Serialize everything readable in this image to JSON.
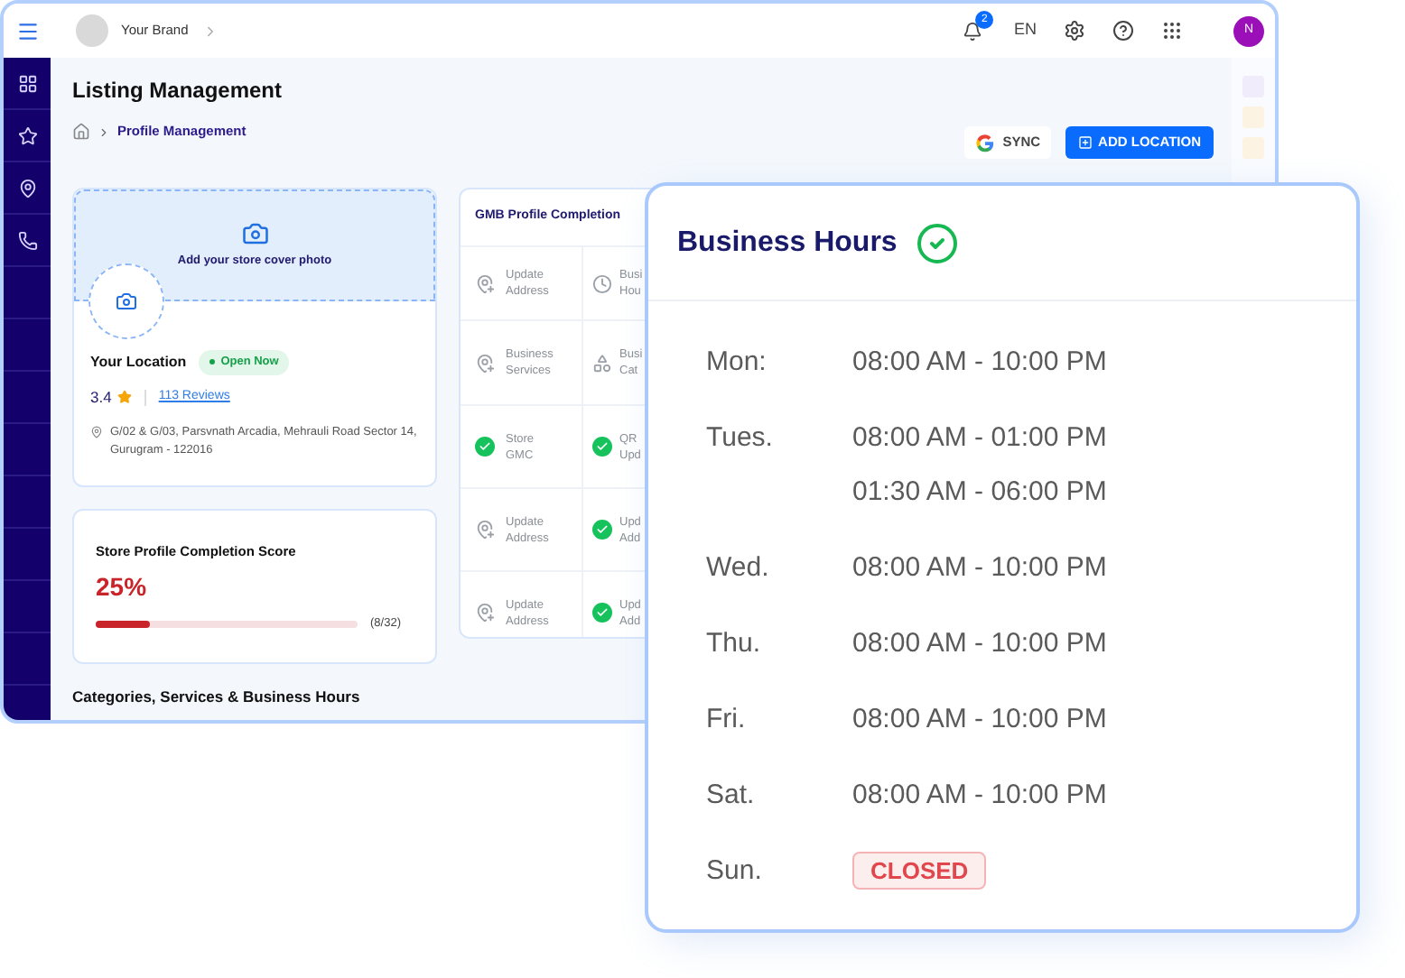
{
  "topbar": {
    "brand": "Your Brand",
    "notifications": "2",
    "language": "EN",
    "avatar": "N"
  },
  "page": {
    "title": "Listing Management",
    "breadcrumb": "Profile Management",
    "buttons": [
      {
        "kind": "sync",
        "label": "SYNC"
      },
      {
        "kind": "add",
        "label": "ADD LOCATION"
      }
    ]
  },
  "location_card": {
    "cover_hint": "Add your store cover photo",
    "name": "Your Location",
    "status": "Open Now",
    "rating": "3.4",
    "reviews": "113 Reviews",
    "address": "G/02 & G/03, Parsvnath Arcadia, Mehrauli Road Sector 14, Gurugram - 122016"
  },
  "score_card": {
    "title": "Store Profile Completion Score",
    "percent": "25%",
    "level": 0.21,
    "count": "(8/32)"
  },
  "gmb": {
    "title": "GMB Profile Completion",
    "rows": [
      [
        {
          "kind": "address",
          "done": false,
          "lines": [
            "Update",
            "Address"
          ]
        },
        {
          "kind": "hours",
          "done": false,
          "lines": [
            "Busi",
            "Hou"
          ]
        }
      ],
      [
        {
          "kind": "address",
          "done": false,
          "lines": [
            "Business",
            "Services"
          ]
        },
        {
          "kind": "category",
          "done": false,
          "lines": [
            "Busi",
            "Cat"
          ]
        }
      ],
      [
        {
          "done": true,
          "lines": [
            "Store",
            "GMC"
          ]
        },
        {
          "done": true,
          "lines": [
            "QR",
            "Upd"
          ]
        }
      ],
      [
        {
          "kind": "address",
          "done": false,
          "lines": [
            "Update",
            "Address"
          ]
        },
        {
          "done": true,
          "lines": [
            "Upd",
            "Add"
          ]
        }
      ],
      [
        {
          "kind": "address",
          "done": false,
          "lines": [
            "Update",
            "Address"
          ]
        },
        {
          "done": true,
          "lines": [
            "Upd",
            "Add"
          ]
        }
      ]
    ]
  },
  "section_heading": "Categories, Services & Business Hours",
  "business_hours": {
    "title": "Business Hours",
    "verified": true,
    "days": [
      {
        "day": "Mon:",
        "closed": false,
        "times": [
          "08:00 AM - 10:00 PM"
        ]
      },
      {
        "day": "Tues.",
        "closed": false,
        "times": [
          "08:00 AM - 01:00 PM",
          "01:30 AM - 06:00 PM"
        ]
      },
      {
        "day": "Wed.",
        "closed": false,
        "times": [
          "08:00 AM - 10:00 PM"
        ]
      },
      {
        "day": "Thu.",
        "closed": false,
        "times": [
          "08:00 AM - 10:00 PM"
        ]
      },
      {
        "day": "Fri.",
        "closed": false,
        "times": [
          "08:00 AM - 10:00 PM"
        ]
      },
      {
        "day": "Sat.",
        "closed": false,
        "times": [
          "08:00 AM - 10:00 PM"
        ]
      },
      {
        "day": "Sun.",
        "closed": true,
        "times": [
          "CLOSED"
        ]
      }
    ]
  }
}
